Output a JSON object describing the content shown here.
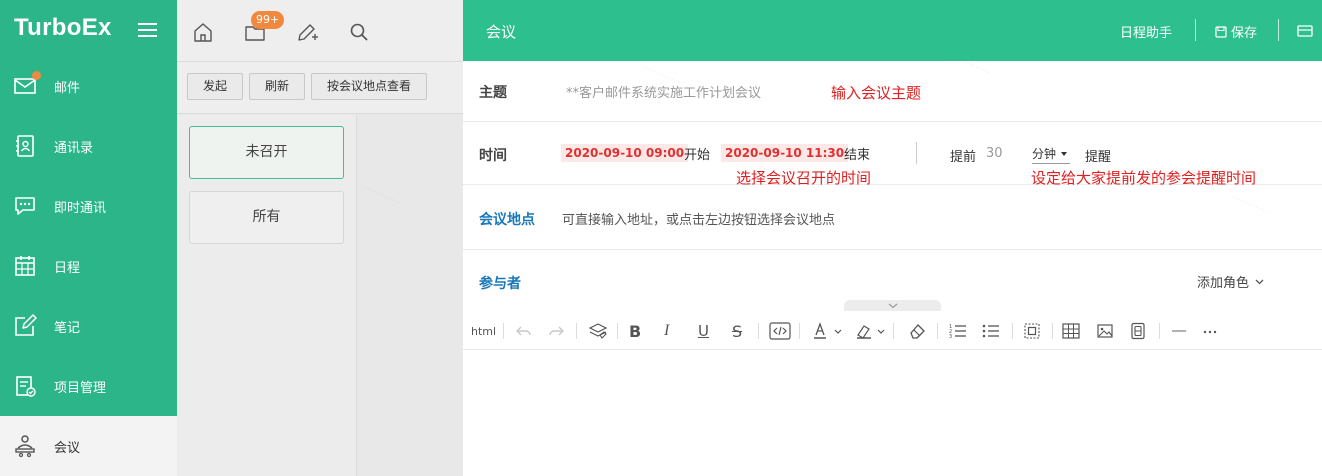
{
  "app": {
    "brand": "TurboEx"
  },
  "sidebar": {
    "items": [
      {
        "label": "邮件",
        "icon": "mail-icon",
        "active": false,
        "has_dot": true
      },
      {
        "label": "通讯录",
        "icon": "contacts-icon",
        "active": false
      },
      {
        "label": "即时通讯",
        "icon": "chat-icon",
        "active": false
      },
      {
        "label": "日程",
        "icon": "calendar-icon",
        "active": false
      },
      {
        "label": "笔记",
        "icon": "note-icon",
        "active": false
      },
      {
        "label": "项目管理",
        "icon": "project-icon",
        "active": false
      },
      {
        "label": "会议",
        "icon": "meeting-icon",
        "active": true
      }
    ]
  },
  "toolbar": {
    "badge": "99+",
    "icons": [
      "home-icon",
      "folder-icon",
      "compose-icon",
      "search-icon"
    ]
  },
  "actions": {
    "start": "发起",
    "refresh": "刷新",
    "by_location": "按会议地点查看"
  },
  "filters": {
    "not_held": "未召开",
    "all": "所有"
  },
  "header": {
    "title": "会议",
    "assistant": "日程助手",
    "save": "保存"
  },
  "form": {
    "subject_label": "主题",
    "subject_placeholder": "**客户邮件系统实施工作计划会议",
    "subject_annotation": "输入会议主题",
    "time_label": "时间",
    "start_datetime": "2020-09-10 09:00",
    "start_word": "开始",
    "end_datetime": "2020-09-10 11:30",
    "end_word": "结束",
    "time_annotation": "选择会议召开的时间",
    "remind_before": "提前",
    "remind_value": "30",
    "remind_unit": "分钟",
    "remind_word": "提醒",
    "remind_annotation": "设定给大家提前发的参会提醒时间",
    "location_label": "会议地点",
    "location_placeholder": "可直接输入地址，或点击左边按钮选择会议地点",
    "attendees_label": "参与者",
    "add_role": "添加角色"
  },
  "editor": {
    "html_label": "html"
  },
  "colors": {
    "sidebar": "#2db58a",
    "header": "#2ebf8f",
    "badge": "#f0883e",
    "annotation": "#e02020",
    "link_label": "#1a78b8"
  }
}
